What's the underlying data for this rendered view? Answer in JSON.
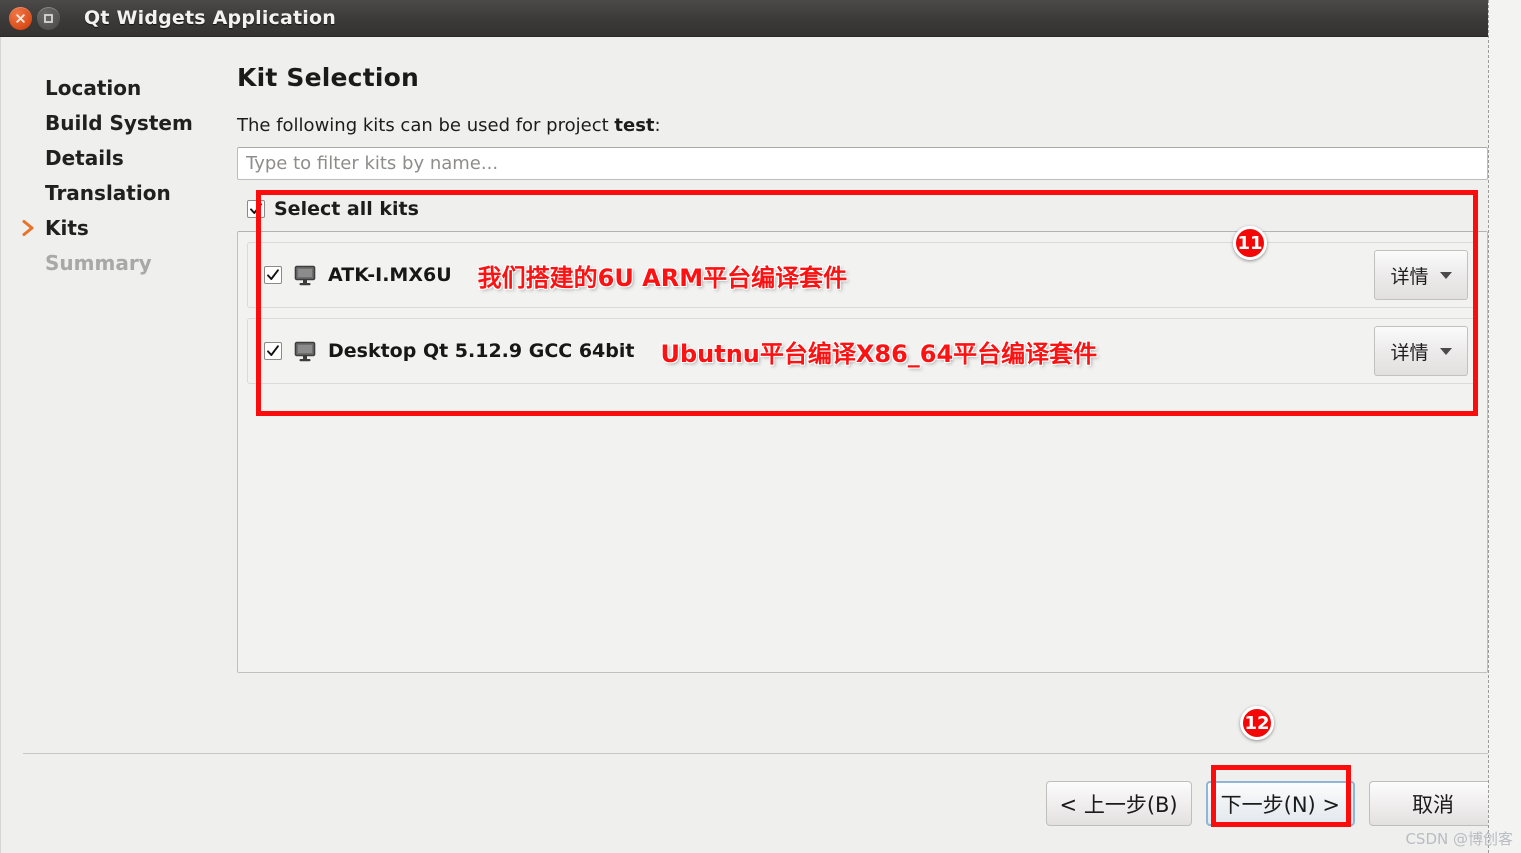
{
  "window": {
    "title": "Qt Widgets Application",
    "close_icon": "close-icon",
    "maximize_icon": "maximize-icon"
  },
  "sidebar": {
    "items": [
      {
        "label": "Location",
        "state": "done"
      },
      {
        "label": "Build System",
        "state": "done"
      },
      {
        "label": "Details",
        "state": "done"
      },
      {
        "label": "Translation",
        "state": "done"
      },
      {
        "label": "Kits",
        "state": "current"
      },
      {
        "label": "Summary",
        "state": "disabled"
      }
    ]
  },
  "main": {
    "page_title": "Kit Selection",
    "description_prefix": "The following kits can be used for project ",
    "description_project": "test",
    "description_suffix": ":",
    "filter_placeholder": "Type to filter kits by name...",
    "filter_value": "",
    "select_all_label": "Select all kits",
    "select_all_checked": true,
    "kits": [
      {
        "name": "ATK-I.MX6U",
        "checked": true,
        "icon": "desktop-monitor-icon",
        "detail_label": "详情",
        "annotation": "我们搭建的6U ARM平台编译套件"
      },
      {
        "name": "Desktop Qt 5.12.9 GCC 64bit",
        "checked": true,
        "icon": "desktop-monitor-icon",
        "detail_label": "详情",
        "annotation": "Ubutnu平台编译X86_64平台编译套件"
      }
    ]
  },
  "footer": {
    "back_label": "< 上一步(B)",
    "next_label": "下一步(N) >",
    "cancel_label": "取消"
  },
  "annotations": {
    "badge_kits": "11",
    "badge_next": "12",
    "highlight_color": "#fc0d0d",
    "note_color": "#fb1212"
  },
  "watermark": "CSDN @博创客"
}
